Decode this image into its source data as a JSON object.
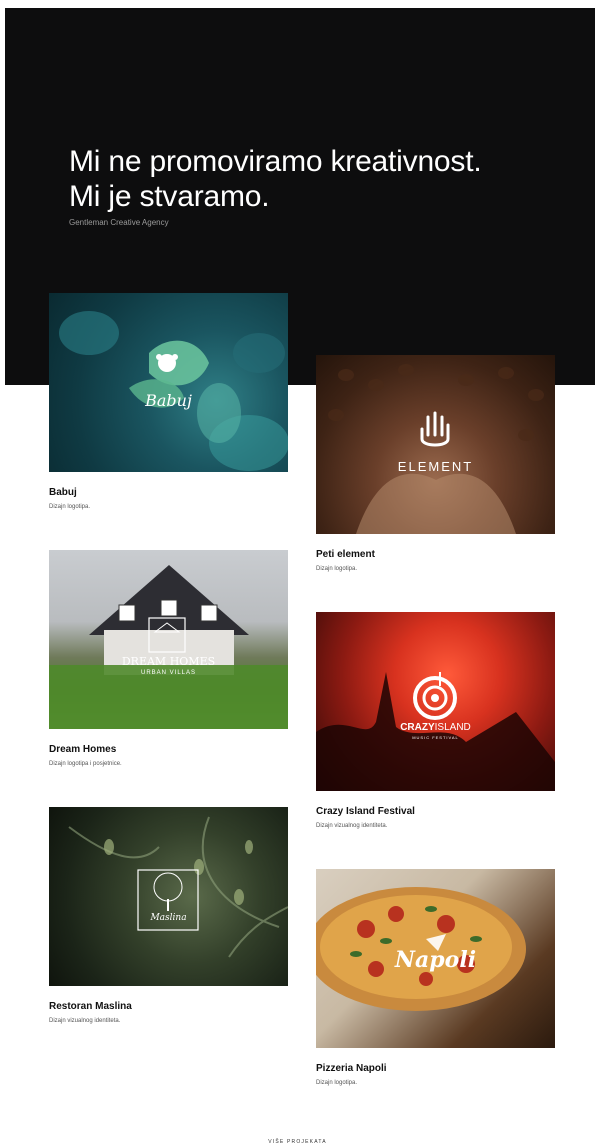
{
  "hero": {
    "title_line1": "Mi ne promoviramo kreativnost.",
    "title_line2": "Mi je stvaramo.",
    "subtitle": "Gentleman Creative Agency"
  },
  "projects": [
    {
      "title": "Babuj",
      "description": "Dizajn logotipa.",
      "logo_text": "Babuj"
    },
    {
      "title": "Peti element",
      "description": "Dizajn logotipa.",
      "logo_text": "ELEMENT"
    },
    {
      "title": "Dream Homes",
      "description": "Dizajn logotipa i posjetnice.",
      "logo_text": "DREAM HOMES",
      "logo_subtext": "URBAN VILLAS"
    },
    {
      "title": "Crazy Island Festival",
      "description": "Dizajn vizualnog identiteta.",
      "logo_text_bold": "CRAZY",
      "logo_text_light": "ISLAND",
      "logo_subtext": "MUSIC FESTIVAL"
    },
    {
      "title": "Restoran Maslina",
      "description": "Dizajn vizualnog identiteta.",
      "logo_text": "Maslina"
    },
    {
      "title": "Pizzeria Napoli",
      "description": "Dizajn logotipa.",
      "logo_text": "Napoli"
    }
  ],
  "more_projects_label": "VIŠE PROJEKATA",
  "colors": {
    "hero_bg": "#0d0d0e",
    "text": "#111111"
  }
}
